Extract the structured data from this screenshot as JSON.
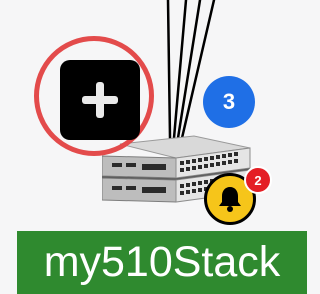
{
  "device": {
    "name": "my510Stack",
    "label_color": "#2f8a2f"
  },
  "expand_button": {
    "icon": "plus-icon",
    "highlight_color": "#e34b4b"
  },
  "child_count_badge": {
    "count": "3",
    "color": "#1f6fe6"
  },
  "alarm": {
    "icon": "bell-icon",
    "count": "2",
    "bell_color": "#f6c51a",
    "badge_color": "#e41e25"
  },
  "connections": {
    "icon": "cable-lines"
  }
}
